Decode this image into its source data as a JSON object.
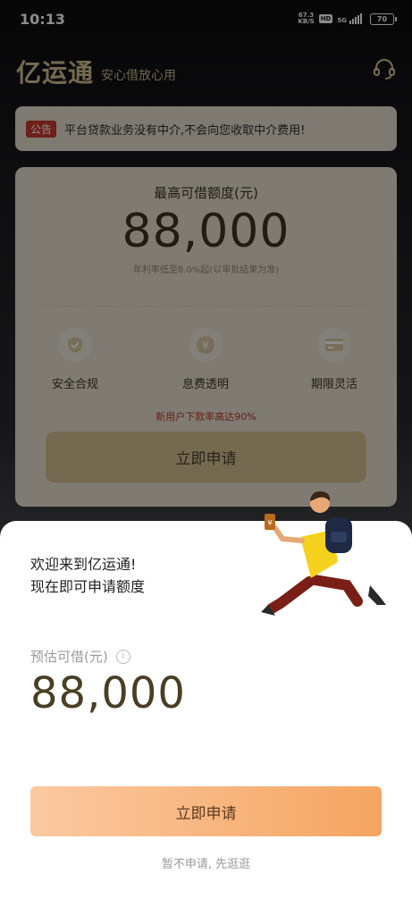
{
  "status_bar": {
    "time": "10:13",
    "net_speed_value": "67.3",
    "net_speed_unit": "KB/S",
    "hd_label": "HD",
    "signal_label": "5G",
    "battery": "70"
  },
  "header": {
    "brand": "亿运通",
    "slogan": "安心借放心用",
    "support_icon": "headset-icon"
  },
  "notice": {
    "tag": "公告",
    "text": "平台贷款业务没有中介,不会向您收取中介费用!"
  },
  "card": {
    "title": "最高可借额度(元)",
    "amount": "88,000",
    "rate_note": "年利率低至8.0%起(以审批结果为准)",
    "features": [
      {
        "label": "安全合规",
        "icon": "shield-icon"
      },
      {
        "label": "息费透明",
        "icon": "yuan-coin-icon"
      },
      {
        "label": "期限灵活",
        "icon": "card-icon"
      }
    ],
    "promo": "新用户下款率高达90%",
    "apply_label": "立即申请"
  },
  "sheet": {
    "welcome_line1": "欢迎来到亿运通!",
    "welcome_line2": "现在即可申请额度",
    "estimate_label": "预估可借(元)",
    "info_icon": "i",
    "estimate_amount": "88,000",
    "apply_label": "立即申请",
    "skip_label": "暂不申请, 先逛逛"
  },
  "colors": {
    "brand_gold": "#d4c193",
    "card_bg": "#e7e0d1",
    "promo_red": "#c0392b",
    "apply_gradient_start": "#fbc9a1",
    "apply_gradient_end": "#f5a561",
    "amount_brown": "#4a3f24"
  }
}
